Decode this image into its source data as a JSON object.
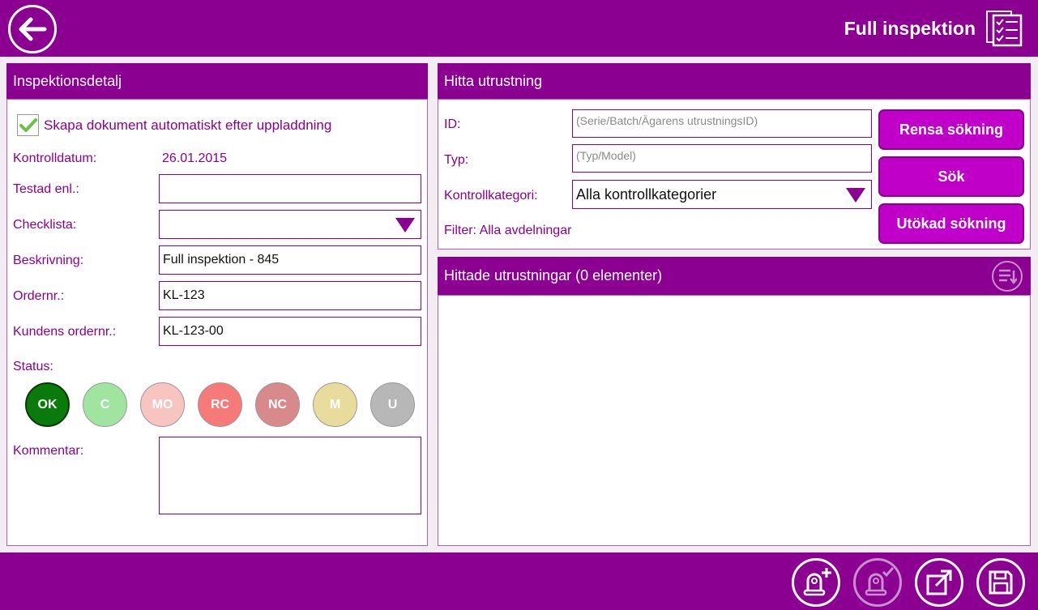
{
  "header": {
    "title": "Full inspektion",
    "back_icon": "arrow-left-icon",
    "doc_icon": "checklist-document-icon"
  },
  "colors": {
    "brand": "#8b0090",
    "button": "#c000c8",
    "panel_bg": "#f3ecf3"
  },
  "inspection_detail": {
    "header": "Inspektionsdetalj",
    "auto_create": {
      "label": "Skapa dokument automatiskt efter uppladdning",
      "checked": true
    },
    "control_date": {
      "label": "Kontrolldatum:",
      "value": "26.01.2015"
    },
    "tested_by": {
      "label": "Testad enl.:",
      "value": ""
    },
    "checklist": {
      "label": "Checklista:",
      "value": ""
    },
    "description": {
      "label": "Beskrivning:",
      "value": "Full inspektion - 845"
    },
    "order_no": {
      "label": "Ordernr.:",
      "value": "KL-123"
    },
    "customer_order_no": {
      "label": "Kundens ordernr.:",
      "value": "KL-123-00"
    },
    "status": {
      "label": "Status:",
      "options": [
        {
          "code": "OK",
          "color": "#0a7a0a",
          "selected": true
        },
        {
          "code": "C",
          "color": "#9fe59f",
          "selected": false
        },
        {
          "code": "MO",
          "color": "#f7c4c0",
          "selected": false
        },
        {
          "code": "RC",
          "color": "#f57a78",
          "selected": false
        },
        {
          "code": "NC",
          "color": "#d88a8a",
          "selected": false
        },
        {
          "code": "M",
          "color": "#e8dc9c",
          "selected": false
        },
        {
          "code": "U",
          "color": "#b7b7b7",
          "selected": false
        }
      ]
    },
    "comment": {
      "label": "Kommentar:",
      "value": ""
    }
  },
  "find_equipment": {
    "header": "Hitta utrustning",
    "id": {
      "label": "ID:",
      "placeholder": "(Serie/Batch/Ägarens utrustningsID)"
    },
    "type": {
      "label": "Typ:",
      "placeholder": "(Typ/Model)"
    },
    "category": {
      "label": "Kontrollkategori:",
      "value": "Alla kontrollkategorier"
    },
    "filter": "Filter: Alla avdelningar",
    "buttons": {
      "clear": "Rensa sökning",
      "search": "Sök",
      "advanced": "Utökad sökning"
    }
  },
  "results": {
    "header": "Hittade utrustningar (0 elementer)",
    "sort_icon": "sort-list-icon"
  },
  "footer": {
    "actions": [
      {
        "name": "add-equipment",
        "icon": "shackle-plus-icon",
        "enabled": true
      },
      {
        "name": "confirm-equipment",
        "icon": "shackle-check-icon",
        "enabled": false
      },
      {
        "name": "export",
        "icon": "external-link-icon",
        "enabled": true
      },
      {
        "name": "save",
        "icon": "floppy-disk-icon",
        "enabled": true
      }
    ]
  }
}
